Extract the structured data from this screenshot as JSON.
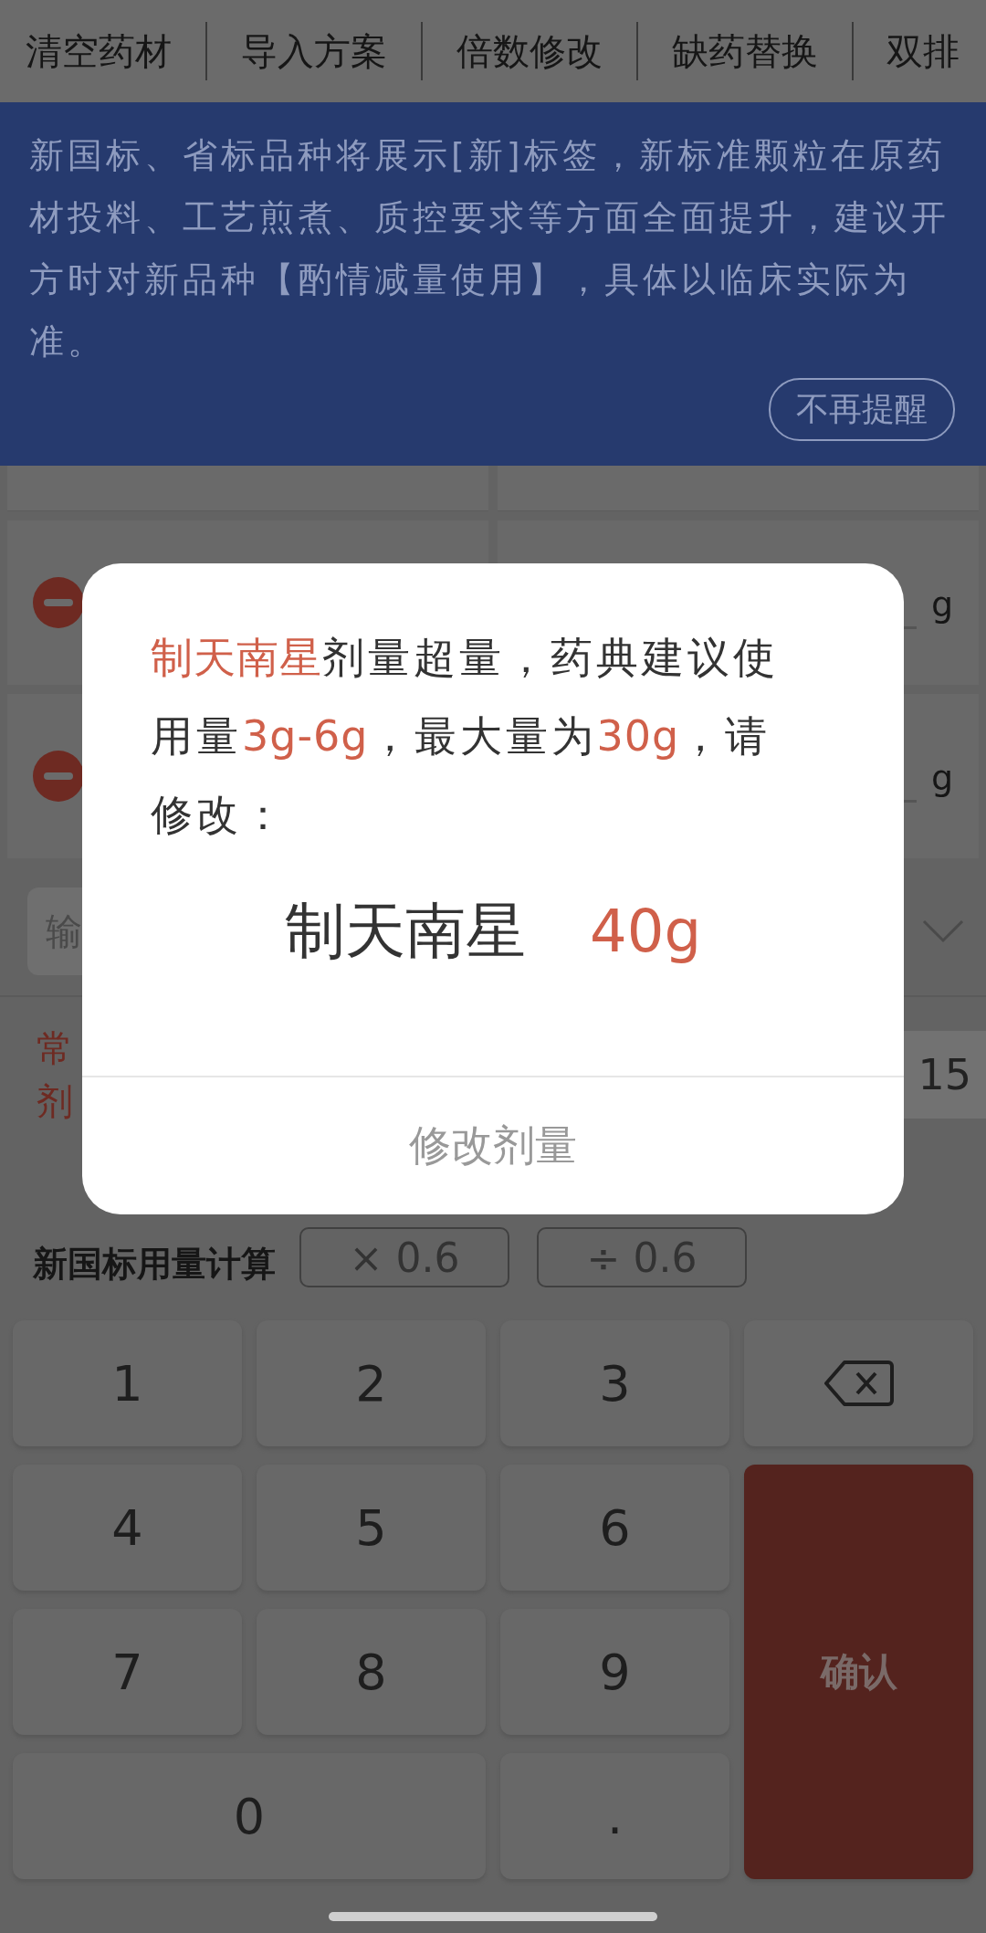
{
  "top_tabs": [
    {
      "label": "清空药材"
    },
    {
      "label": "导入方案"
    },
    {
      "label": "倍数修改"
    },
    {
      "label": "缺药替换"
    },
    {
      "label": "双排"
    }
  ],
  "notice": {
    "text": "新国标、省标品种将展示[新]标签，新标准颗粒在原药材投料、工艺煎煮、质控要求等方面全面提升，建议开方时对新品种【酌情减量使用】，具体以临床实际为准。",
    "dismiss": "不再提醒"
  },
  "herb_rows": [
    {
      "unit": "g"
    },
    {
      "unit": "g"
    }
  ],
  "input_row": {
    "placeholder": "输"
  },
  "usage": {
    "label_lines": [
      "常",
      "剂"
    ],
    "value": "15"
  },
  "calc": {
    "label": "新国标用量计算",
    "buttons": [
      "× 0.6",
      "÷ 0.6"
    ]
  },
  "keypad": [
    {
      "kind": "digit",
      "label": "1"
    },
    {
      "kind": "digit",
      "label": "2"
    },
    {
      "kind": "digit",
      "label": "3"
    },
    {
      "kind": "backspace"
    },
    {
      "kind": "digit",
      "label": "4"
    },
    {
      "kind": "digit",
      "label": "5"
    },
    {
      "kind": "digit",
      "label": "6"
    },
    {
      "kind": "digit",
      "label": "7"
    },
    {
      "kind": "digit",
      "label": "8"
    },
    {
      "kind": "digit",
      "label": "9"
    },
    {
      "kind": "confirm",
      "label": "确认"
    },
    {
      "kind": "wide",
      "label": "0"
    },
    {
      "kind": "digit",
      "label": "."
    }
  ],
  "dialog": {
    "message": [
      {
        "text": "制天南星",
        "highlight": true
      },
      {
        "text": "剂量超量，药典建议使用量",
        "highlight": false
      },
      {
        "text": "3g-6g",
        "highlight": true
      },
      {
        "text": "，最大量为",
        "highlight": false
      },
      {
        "text": "30g",
        "highlight": true
      },
      {
        "text": "，请修改：",
        "highlight": false
      }
    ],
    "herb": "制天南星",
    "dose": "40g",
    "action": "修改剂量"
  }
}
